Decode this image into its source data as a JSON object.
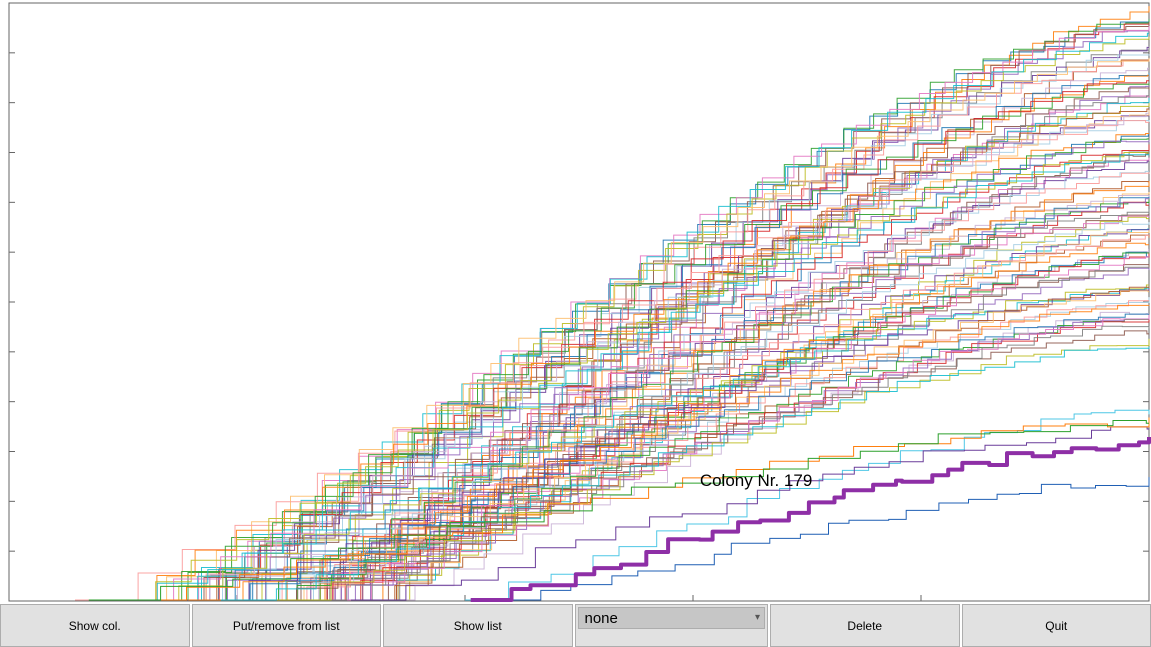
{
  "chart_data": {
    "type": "line",
    "description": "Many overlapping monotone step/staircase curves (colony growth traces). Each series is a step function that rises from near y=0 on the left to a plateau on the right. Series are distinguished by hue; one highlighted thick purple trace is labeled.",
    "x_range": [
      0,
      100
    ],
    "y_range": [
      0,
      100
    ],
    "y_ticks_count": 13,
    "series_count": 90,
    "palette": [
      "#1f77b4",
      "#ff7f0e",
      "#2ca02c",
      "#d62728",
      "#9467bd",
      "#8c564b",
      "#e377c2",
      "#7f7f7f",
      "#bcbd22",
      "#17becf",
      "#6a3d9a",
      "#b15928",
      "#a6cee3",
      "#fb9a99",
      "#fdbf6f",
      "#cab2d6"
    ],
    "highlighted": {
      "label": "Colony Nr. 179",
      "color": "#8e2fa6",
      "stroke_width": 4,
      "x_start_frac": 0.405,
      "y_end_frac": 0.27,
      "label_pos_frac": {
        "x": 0.606,
        "y": 0.8
      }
    },
    "band": {
      "x_start_min_frac": 0.04,
      "x_start_max_frac": 0.33,
      "y_top_min_frac": 0.985,
      "y_top_max_frac": 0.44
    },
    "outliers": [
      {
        "x_start_frac": 0.4,
        "y_end_frac": 0.32,
        "color": "#4fc7e6"
      },
      {
        "x_start_frac": 0.42,
        "y_end_frac": 0.2,
        "color": "#1f5fb4"
      },
      {
        "x_start_frac": 0.3,
        "y_end_frac": 0.29,
        "color": "#6a3d9a"
      },
      {
        "x_start_frac": 0.09,
        "y_end_frac": 0.3,
        "color": "#ff7f0e"
      },
      {
        "x_start_frac": 0.07,
        "y_end_frac": 0.3,
        "color": "#2ca02c"
      }
    ]
  },
  "annotation": {
    "text": "Colony Nr. 179"
  },
  "toolbar": {
    "show_col_label": "Show col.",
    "put_remove_label": "Put/remove from list",
    "show_list_label": "Show list",
    "select_value": "none",
    "delete_label": "Delete",
    "quit_label": "Quit"
  }
}
